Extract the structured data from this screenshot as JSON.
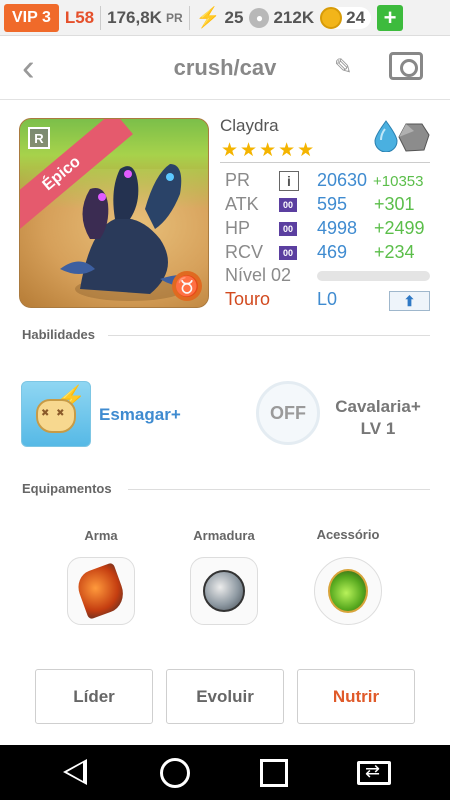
{
  "status_bar": {
    "vip": "VIP 3",
    "level": "L58",
    "power": "176,8K",
    "power_unit": "PR",
    "energy": "25",
    "paw": "212K",
    "coins": "24",
    "plus": "+"
  },
  "header": {
    "title": "crush/cav",
    "back_icon": "chevron-left-icon",
    "edit_icon": "pencil-icon",
    "camera_icon": "camera-icon"
  },
  "monster": {
    "rarity": "Épico",
    "rank_badge": "R",
    "zodiac_symbol": "♉",
    "name": "Claydra",
    "stars": "★★★★★",
    "stats": [
      {
        "label": "PR",
        "value": "20630",
        "bonus": "+10353",
        "badge": "i"
      },
      {
        "label": "ATK",
        "value": "595",
        "bonus": "+301",
        "badge": "00"
      },
      {
        "label": "HP",
        "value": "4998",
        "bonus": "+2499",
        "badge": "00"
      },
      {
        "label": "RCV",
        "value": "469",
        "bonus": "+234",
        "badge": "00"
      }
    ],
    "level_label": "Nível 02",
    "xp_progress": 0,
    "sign": "Touro",
    "lo": "L0"
  },
  "abilities": {
    "section_title": "Habilidades",
    "skill1": "Esmagar+",
    "skill2_status": "OFF",
    "skill2_name": "Cavalaria+",
    "skill2_level": "LV 1"
  },
  "equipment": {
    "section_title": "Equipamentos",
    "slots": [
      "Arma",
      "Armadura",
      "Acessório"
    ]
  },
  "actions": {
    "leader": "Líder",
    "evolve": "Evoluir",
    "feed": "Nutrir"
  },
  "colors": {
    "accent_orange": "#e05a2a",
    "value_blue": "#3f8bd0",
    "bonus_green": "#5bbe4a",
    "vip_orange": "#f06a2a"
  }
}
